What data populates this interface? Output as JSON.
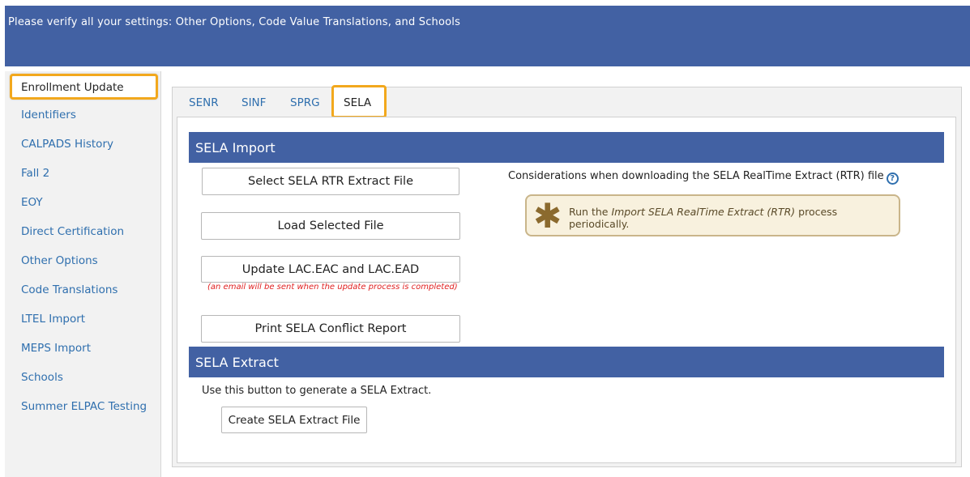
{
  "header": {
    "title": "Please verify all your settings: Other Options, Code Value Translations, and Schools"
  },
  "sidebar": {
    "active": "Enrollment Update",
    "items": [
      "Identifiers",
      "CALPADS History",
      "Fall 2",
      "EOY",
      "Direct Certification",
      "Other Options",
      "Code Translations",
      "LTEL Import",
      "MEPS Import",
      "Schools",
      "Summer ELPAC Testing"
    ]
  },
  "tabs": {
    "items": [
      "SENR",
      "SINF",
      "SPRG"
    ],
    "active": "SELA"
  },
  "sela_import": {
    "title": "SELA Import",
    "select_button": "Select SELA RTR Extract File",
    "load_button": "Load Selected File",
    "update_button": "Update LAC.EAC and LAC.EAD",
    "update_note": "(an email will be sent when the update process is completed)",
    "print_button": "Print SELA Conflict Report",
    "considerations": "Considerations when downloading the SELA RealTime Extract (RTR) file",
    "help_symbol": "?",
    "tip_star": "✱",
    "tip_prefix": "Run the ",
    "tip_italic": "Import SELA RealTime Extract (RTR)",
    "tip_suffix": " process periodically."
  },
  "sela_extract": {
    "title": "SELA Extract",
    "description": "Use this button to generate a SELA Extract.",
    "button": "Create SELA Extract File"
  },
  "colors": {
    "header": "#4261a3",
    "accent_highlight": "#f2a81d",
    "link": "#2f6fae",
    "note": "#e02020"
  }
}
